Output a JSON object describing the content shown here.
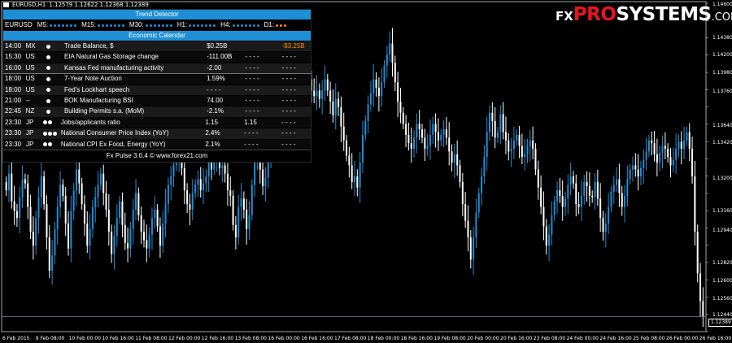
{
  "symbol": {
    "name": "EURUSD,H1",
    "ohlc": "1.12579 1.12622 1.12368 1.12389"
  },
  "brand": {
    "fx": "FX",
    "pro": "PRO",
    "systems": "SYSTEMS",
    "com": ".COM"
  },
  "trend_detector": {
    "title": "Trend Detector",
    "pair": "EURUSD",
    "timeframes": [
      {
        "label": "M5:",
        "dot_color": "#1e8fd6"
      },
      {
        "label": "M15:",
        "dot_color": "#1e8fd6"
      },
      {
        "label": "M30:",
        "dot_color": "#1e8fd6"
      },
      {
        "label": "H1:",
        "dot_color": "#1e8fd6"
      },
      {
        "label": "H4:",
        "dot_color": "#1e8fd6"
      },
      {
        "label": "D1:",
        "dot_color": "#ff8a00"
      }
    ]
  },
  "calendar": {
    "title": "Economic Calendar",
    "rows": [
      {
        "time": "14:00",
        "cc": "MX",
        "imp": 1,
        "name": "Trade Balance, $",
        "prev": "$0.25B",
        "fc": "",
        "act": "-$3.25B",
        "act_color": "#ff8a00"
      },
      {
        "time": "15:30",
        "cc": "US",
        "imp": 1,
        "name": "EIA Natural Gas Storage change",
        "prev": "-111.00B",
        "fc": "- - - -",
        "act": "- - - -",
        "act_color": "#ffffff"
      },
      {
        "time": "16:00",
        "cc": "US",
        "imp": 1,
        "name": "Kansas Fed manufacturing activity",
        "prev": "-2.00",
        "fc": "- - - -",
        "act": "- - - -",
        "act_color": "#ffffff"
      },
      {
        "time": "18:00",
        "cc": "US",
        "imp": 1,
        "name": "7-Year Note Auction",
        "prev": "1.59%",
        "fc": "- - - -",
        "act": "- - - -",
        "act_color": "#ffffff"
      },
      {
        "time": "18:00",
        "cc": "US",
        "imp": 1,
        "name": "Fed's Lockhart speech",
        "prev": "- - - -",
        "fc": "- - - -",
        "act": "- - - -",
        "act_color": "#ffffff"
      },
      {
        "time": "21:00",
        "cc": "--",
        "imp": 1,
        "name": "BOK Manufacturing BSI",
        "prev": "74.00",
        "fc": "- - - -",
        "act": "- - - -",
        "act_color": "#ffffff"
      },
      {
        "time": "22:45",
        "cc": "NZ",
        "imp": 1,
        "name": "Building Permits s.a. (MoM)",
        "prev": "-2.1%",
        "fc": "- - - -",
        "act": "- - - -",
        "act_color": "#ffffff"
      },
      {
        "time": "23:30",
        "cc": "JP",
        "imp": 2,
        "name": "Jobs/applicants ratio",
        "prev": "1.15",
        "fc": "1.15",
        "act": "- - - -",
        "act_color": "#ffffff"
      },
      {
        "time": "23:30",
        "cc": "JP",
        "imp": 3,
        "name": "National Consumer Price Index (YoY)",
        "prev": "2.4%",
        "fc": "- - - -",
        "act": "- - - -",
        "act_color": "#ffffff"
      },
      {
        "time": "23:30",
        "cc": "JP",
        "imp": 2,
        "name": "National CPI Ex Food, Energy (YoY)",
        "prev": "2.1%",
        "fc": "- - - -",
        "act": "- - - -",
        "act_color": "#ffffff"
      }
    ],
    "footer": "Fx Pulse 3.0.4 © www.forex21.com"
  },
  "price_axis": {
    "labels": [
      "1.14600",
      "1.14380",
      "1.14200",
      "1.13980",
      "1.13760",
      "1.13640",
      "1.13420",
      "1.13200",
      "1.13160",
      "1.12940",
      "1.12820",
      "1.12600",
      "1.12560",
      "1.12440"
    ],
    "current": "1.12389"
  },
  "time_axis": {
    "labels": [
      "6 Feb 2015",
      "9 Feb 08:00",
      "10 Feb 00:00",
      "10 Feb 16:00",
      "11 Feb 08:00",
      "12 Feb 00:00",
      "12 Feb 16:00",
      "13 Feb 08:00",
      "16 Feb 00:00",
      "16 Feb 16:00",
      "17 Feb 08:00",
      "18 Feb 00:00",
      "18 Feb 16:00",
      "19 Feb 08:00",
      "20 Feb 00:00",
      "20 Feb 16:00",
      "23 Feb 08:00",
      "24 Feb 00:00",
      "24 Feb 16:00",
      "25 Feb 08:00",
      "26 Feb 00:00",
      "26 Feb 16:00"
    ]
  },
  "chart_data": {
    "type": "candlestick",
    "symbol": "EURUSD",
    "timeframe": "H1",
    "ylim": [
      1.1228,
      1.1465
    ],
    "bull_color": "#1e8fd6",
    "bear_color": "#ffffff",
    "closes": [
      1.133,
      1.1342,
      1.1322,
      1.1315,
      1.131,
      1.1325,
      1.1338,
      1.1335,
      1.1318,
      1.13,
      1.129,
      1.131,
      1.1325,
      1.134,
      1.132,
      1.1296,
      1.1272,
      1.1283,
      1.1302,
      1.1318,
      1.1334,
      1.1326,
      1.1306,
      1.1288,
      1.1315,
      1.133,
      1.1345,
      1.1335,
      1.132,
      1.1306,
      1.129,
      1.1302,
      1.1318,
      1.1325,
      1.1334,
      1.1342,
      1.1328,
      1.1316,
      1.13,
      1.1284,
      1.1297,
      1.131,
      1.1322,
      1.1305,
      1.1292,
      1.1288,
      1.1302,
      1.1316,
      1.1328,
      1.1312,
      1.13,
      1.1294,
      1.1288,
      1.1298,
      1.131,
      1.1316,
      1.1304,
      1.129,
      1.1306,
      1.132,
      1.1334,
      1.134,
      1.1348,
      1.1352,
      1.1355,
      1.1346,
      1.133,
      1.132,
      1.1316,
      1.1328,
      1.1334,
      1.1338,
      1.133,
      1.1335,
      1.134,
      1.135,
      1.1345,
      1.1352,
      1.1358,
      1.1346,
      1.1348,
      1.1342,
      1.133,
      1.1326,
      1.1305,
      1.1296,
      1.1318,
      1.1324,
      1.1316,
      1.1302,
      1.1312,
      1.1334,
      1.135,
      1.136,
      1.1345,
      1.1333,
      1.1339,
      1.135,
      1.1365,
      1.1374,
      1.1387,
      1.1402,
      1.1415,
      1.1405,
      1.1392,
      1.1396,
      1.1412,
      1.1424,
      1.142,
      1.1406,
      1.1396,
      1.1404,
      1.141,
      1.1402,
      1.1398,
      1.1402,
      1.1396,
      1.1402,
      1.141,
      1.1402,
      1.1394,
      1.1384,
      1.1396,
      1.139,
      1.1376,
      1.1366,
      1.1355,
      1.1348,
      1.1336,
      1.134,
      1.1332,
      1.135,
      1.137,
      1.138,
      1.1392,
      1.14,
      1.141,
      1.1404,
      1.1398,
      1.1408,
      1.142,
      1.1428,
      1.1436,
      1.1422,
      1.1408,
      1.1394,
      1.1386,
      1.1378,
      1.137,
      1.1364,
      1.136,
      1.1368,
      1.1378,
      1.1374,
      1.1368,
      1.136,
      1.1362,
      1.137,
      1.1378,
      1.1372,
      1.1366,
      1.137,
      1.1374,
      1.1368,
      1.1358,
      1.135,
      1.1356,
      1.1348,
      1.1336,
      1.132,
      1.1308,
      1.1296,
      1.128,
      1.1296,
      1.1314,
      1.1328,
      1.134,
      1.1354,
      1.1372,
      1.1386,
      1.138,
      1.1368,
      1.1372,
      1.1385,
      1.1372,
      1.1366,
      1.1358,
      1.136,
      1.1366,
      1.137,
      1.1362,
      1.1354,
      1.1356,
      1.1362,
      1.1366,
      1.136,
      1.1345,
      1.1332,
      1.1318,
      1.1304,
      1.129,
      1.1298,
      1.1312,
      1.1322,
      1.133,
      1.1326,
      1.1318,
      1.1324,
      1.1334,
      1.134,
      1.1335,
      1.132,
      1.1318,
      1.1326,
      1.1336,
      1.1333,
      1.1326,
      1.1325,
      1.1336,
      1.1324,
      1.131,
      1.13,
      1.1306,
      1.1318,
      1.1329,
      1.1334,
      1.1338,
      1.1328,
      1.1318,
      1.1326,
      1.1338,
      1.1345,
      1.1348,
      1.1345,
      1.134,
      1.1346,
      1.1352,
      1.1358,
      1.1366,
      1.1364,
      1.1356,
      1.135,
      1.1357,
      1.1362,
      1.136,
      1.1354,
      1.1348,
      1.1352,
      1.136,
      1.1365,
      1.136,
      1.1366,
      1.1372,
      1.136,
      1.134,
      1.13,
      1.127,
      1.125,
      1.1239
    ]
  }
}
